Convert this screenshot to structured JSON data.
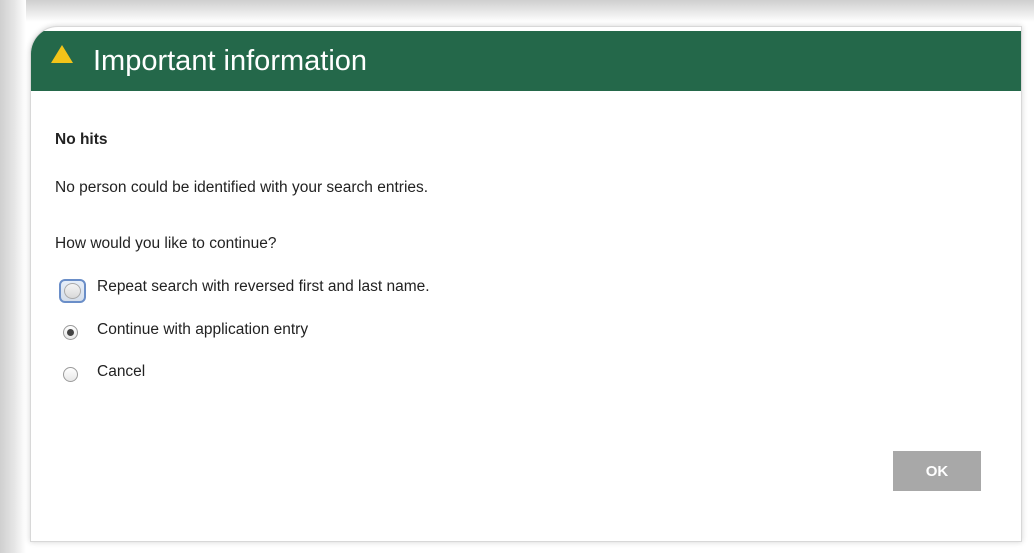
{
  "dialog": {
    "title": "Important information",
    "title_icon": "warning-triangle-icon",
    "heading": "No hits",
    "message": "No person could be identified with your search entries.",
    "question": "How would you like to continue?",
    "options": [
      {
        "label": "Repeat search with reversed first and last name.",
        "checked": false,
        "focused": true
      },
      {
        "label": "Continue with application entry",
        "checked": true,
        "focused": false
      },
      {
        "label": "Cancel",
        "checked": false,
        "focused": false
      }
    ],
    "ok_label": "OK"
  },
  "colors": {
    "titlebar": "#24684a",
    "title_text": "#ffffff",
    "warning_icon": "#f2c419",
    "ok_button": "#a8a8a8"
  }
}
